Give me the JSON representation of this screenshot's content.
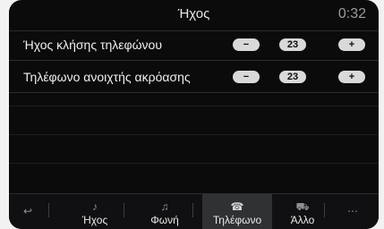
{
  "header": {
    "title": "Ήχος",
    "time": "0:32"
  },
  "settings": [
    {
      "label": "Ήχος κλήσης τηλεφώνου",
      "minus": "−",
      "value": "23",
      "plus": "+"
    },
    {
      "label": "Τηλέφωνο ανοιχτής ακρόασης",
      "minus": "−",
      "value": "23",
      "plus": "+"
    }
  ],
  "bottom_nav": [
    {
      "icon_name": "back-icon",
      "label": ""
    },
    {
      "icon_name": "music-note-icon",
      "label": "Ήχος"
    },
    {
      "icon_name": "voice-icon",
      "label": "Φωνή"
    },
    {
      "icon_name": "phone-icon",
      "label": "Τηλέφωνο"
    },
    {
      "icon_name": "car-icon",
      "label": "Άλλο"
    },
    {
      "icon_name": "more-icon",
      "label": ""
    }
  ]
}
